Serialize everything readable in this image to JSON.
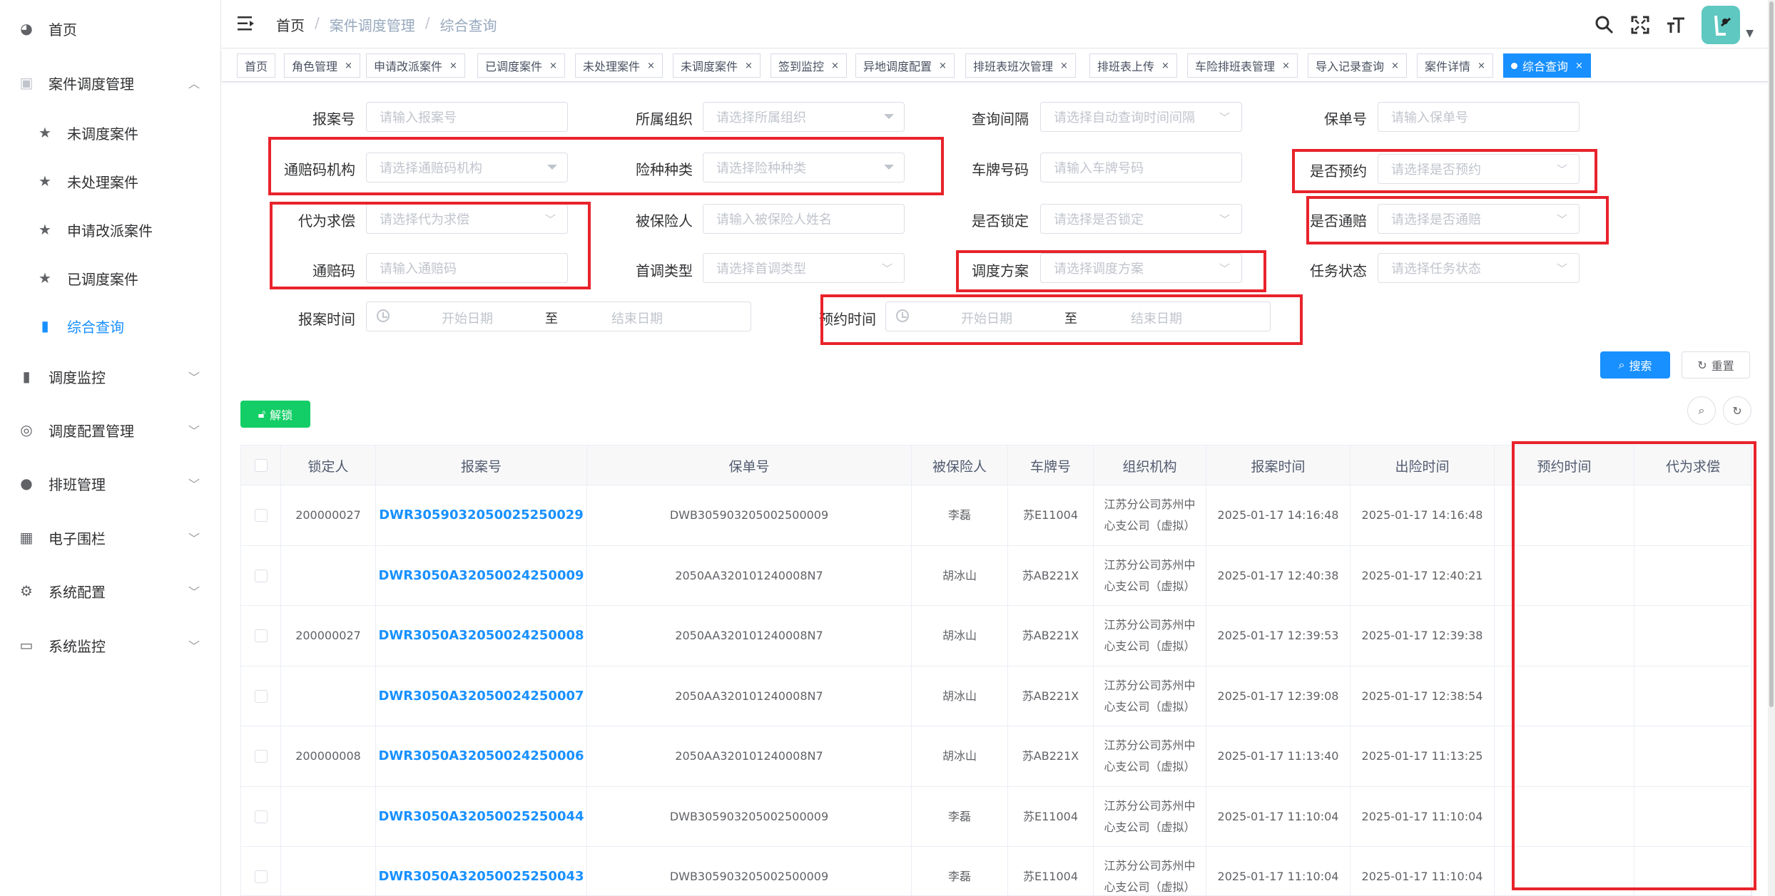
{
  "sidebar": {
    "items": [
      {
        "label": "首页",
        "icon": "dashboard-icon"
      },
      {
        "label": "案件调度管理",
        "icon": "case-icon"
      },
      {
        "label": "未调度案件",
        "icon": "star-icon"
      },
      {
        "label": "未处理案件",
        "icon": "star-icon"
      },
      {
        "label": "申请改派案件",
        "icon": "star-icon"
      },
      {
        "label": "已调度案件",
        "icon": "star-icon"
      },
      {
        "label": "综合查询",
        "icon": "bar-chart-icon"
      },
      {
        "label": "调度监控",
        "icon": "bar-chart-icon"
      },
      {
        "label": "调度配置管理",
        "icon": "config-icon"
      },
      {
        "label": "排班管理",
        "icon": "globe-icon"
      },
      {
        "label": "电子围栏",
        "icon": "grid-icon"
      },
      {
        "label": "系统配置",
        "icon": "gear-icon"
      },
      {
        "label": "系统监控",
        "icon": "monitor-icon"
      }
    ]
  },
  "navbar": {
    "breadcrumb": [
      "首页",
      "案件调度管理",
      "综合查询"
    ],
    "separator": "/"
  },
  "tags": [
    "首页",
    "角色管理",
    "申请改派案件",
    "已调度案件",
    "未处理案件",
    "未调度案件",
    "签到监控",
    "异地调度配置",
    "排班表班次管理",
    "排班表上传",
    "车险排班表管理",
    "导入记录查询",
    "案件详情",
    "综合查询"
  ],
  "form": {
    "report_no": {
      "label": "报案号",
      "placeholder": "请输入报案号"
    },
    "org": {
      "label": "所属组织",
      "placeholder": "请选择所属组织"
    },
    "interval": {
      "label": "查询间隔",
      "placeholder": "请选择自动查询时间间隔"
    },
    "policy_no": {
      "label": "保单号",
      "placeholder": "请输入保单号"
    },
    "tongpei_org": {
      "label": "通赔码机构",
      "placeholder": "请选择通赔码机构"
    },
    "risk_type": {
      "label": "险种种类",
      "placeholder": "请选择险种种类"
    },
    "plate": {
      "label": "车牌号码",
      "placeholder": "请输入车牌号码"
    },
    "is_appoint": {
      "label": "是否预约",
      "placeholder": "请选择是否预约"
    },
    "proxy_claim": {
      "label": "代为求偿",
      "placeholder": "请选择代为求偿"
    },
    "insured": {
      "label": "被保险人",
      "placeholder": "请输入被保险人姓名"
    },
    "is_locked": {
      "label": "是否锁定",
      "placeholder": "请选择是否锁定"
    },
    "is_tongpei": {
      "label": "是否通赔",
      "placeholder": "请选择是否通赔"
    },
    "tongpei_code": {
      "label": "通赔码",
      "placeholder": "请输入通赔码"
    },
    "first_type": {
      "label": "首调类型",
      "placeholder": "请选择首调类型"
    },
    "dispatch_plan": {
      "label": "调度方案",
      "placeholder": "请选择调度方案"
    },
    "task_status": {
      "label": "任务状态",
      "placeholder": "请选择任务状态"
    },
    "report_time": {
      "label": "报案时间",
      "start": "开始日期",
      "to": "至",
      "end": "结束日期"
    },
    "appoint_time": {
      "label": "预约时间",
      "start": "开始日期",
      "to": "至",
      "end": "结束日期"
    },
    "search_label": "搜索",
    "reset_label": "重置",
    "unlock_label": "解锁"
  },
  "table": {
    "columns": [
      "锁定人",
      "报案号",
      "保单号",
      "被保险人",
      "车牌号",
      "组织机构",
      "报案时间",
      "出险时间",
      "预约时间",
      "代为求偿"
    ],
    "rows": [
      {
        "locker": "200000027",
        "report_no": "DWR3059032050025250029",
        "policy_no": "DWB305903205002500009",
        "insured": "李磊",
        "plate": "苏E11004",
        "org1": "江苏分公司苏州中",
        "org2": "心支公司（虚拟）",
        "report_time": "2025-01-17 14:16:48",
        "accident_time": "2025-01-17 14:16:48",
        "appoint_time": "",
        "proxy": ""
      },
      {
        "locker": "",
        "report_no": "DWR3050A32050024250009",
        "policy_no": "2050AA320101240008N7",
        "insured": "胡冰山",
        "plate": "苏AB221X",
        "org1": "江苏分公司苏州中",
        "org2": "心支公司（虚拟）",
        "report_time": "2025-01-17 12:40:38",
        "accident_time": "2025-01-17 12:40:21",
        "appoint_time": "",
        "proxy": ""
      },
      {
        "locker": "200000027",
        "report_no": "DWR3050A32050024250008",
        "policy_no": "2050AA320101240008N7",
        "insured": "胡冰山",
        "plate": "苏AB221X",
        "org1": "江苏分公司苏州中",
        "org2": "心支公司（虚拟）",
        "report_time": "2025-01-17 12:39:53",
        "accident_time": "2025-01-17 12:39:38",
        "appoint_time": "",
        "proxy": ""
      },
      {
        "locker": "",
        "report_no": "DWR3050A32050024250007",
        "policy_no": "2050AA320101240008N7",
        "insured": "胡冰山",
        "plate": "苏AB221X",
        "org1": "江苏分公司苏州中",
        "org2": "心支公司（虚拟）",
        "report_time": "2025-01-17 12:39:08",
        "accident_time": "2025-01-17 12:38:54",
        "appoint_time": "",
        "proxy": ""
      },
      {
        "locker": "200000008",
        "report_no": "DWR3050A32050024250006",
        "policy_no": "2050AA320101240008N7",
        "insured": "胡冰山",
        "plate": "苏AB221X",
        "org1": "江苏分公司苏州中",
        "org2": "心支公司（虚拟）",
        "report_time": "2025-01-17 11:13:40",
        "accident_time": "2025-01-17 11:13:25",
        "appoint_time": "",
        "proxy": ""
      },
      {
        "locker": "",
        "report_no": "DWR3050A32050025250044",
        "policy_no": "DWB305903205002500009",
        "insured": "李磊",
        "plate": "苏E11004",
        "org1": "江苏分公司苏州中",
        "org2": "心支公司（虚拟）",
        "report_time": "2025-01-17 11:10:04",
        "accident_time": "2025-01-17 11:10:04",
        "appoint_time": "",
        "proxy": ""
      },
      {
        "locker": "",
        "report_no": "DWR3050A32050025250043",
        "policy_no": "DWB305903205002500009",
        "insured": "李磊",
        "plate": "苏E11004",
        "org1": "江苏分公司苏州中",
        "org2": "心支公司（虚拟）",
        "report_time": "2025-01-17 11:10:04",
        "accident_time": "2025-01-17 11:10:04",
        "appoint_time": "",
        "proxy": ""
      }
    ]
  },
  "colors": {
    "primary": "#1890ff",
    "success": "#13ce66",
    "highlight": "#e8232b"
  }
}
